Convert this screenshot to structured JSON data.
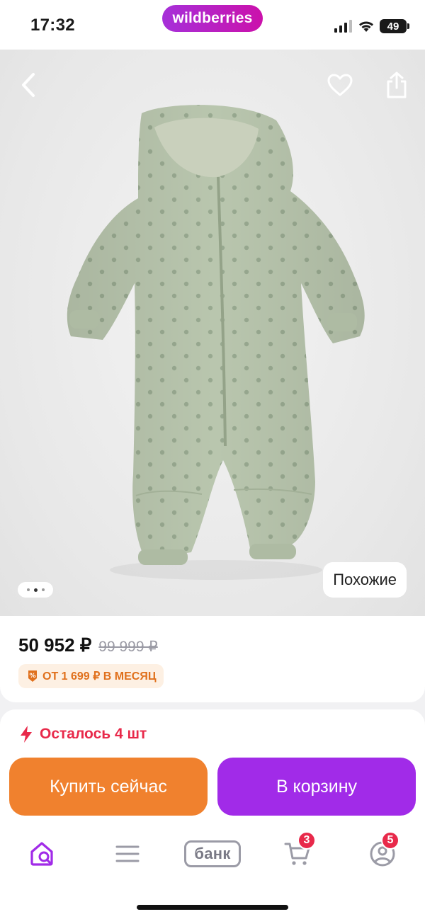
{
  "status_bar": {
    "time": "17:32",
    "brand": "wildberries",
    "battery": "49"
  },
  "gallery": {
    "similar_label": "Похожие",
    "slide_count": 3,
    "active_slide": 2
  },
  "product": {
    "price_current": "50 952 ₽",
    "price_old": "99 999 ₽",
    "installment_label": "ОТ 1 699 ₽ В МЕСЯЦ",
    "stock_label": "Осталось 4 шт"
  },
  "actions": {
    "buy_now_label": "Купить сейчас",
    "add_to_cart_label": "В корзину"
  },
  "tabbar": {
    "bank_label": "банк",
    "cart_badge": "3",
    "profile_badge": "5"
  },
  "colors": {
    "accent": "#a12be8",
    "buy": "#f0812e",
    "alert": "#e8294a",
    "installment": "#e0701c"
  },
  "icons": [
    "back-icon",
    "heart-icon",
    "share-icon",
    "lightning-icon",
    "home-search-icon",
    "menu-icon",
    "cart-icon",
    "profile-icon"
  ]
}
